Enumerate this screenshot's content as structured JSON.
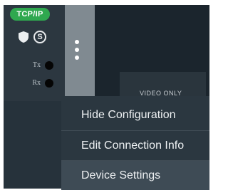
{
  "status": {
    "protocol_badge": "TCP/IP",
    "security_icon": "shield-icon",
    "secure_icon_letter": "S",
    "tx_label": "Tx",
    "rx_label": "Rx"
  },
  "menu_button": {
    "icon": "kebab-menu-icon"
  },
  "video_tile": {
    "label": "VIDEO ONLY"
  },
  "context_menu": {
    "items": [
      {
        "label": "Hide Configuration",
        "highlighted": false
      },
      {
        "label": "Edit Connection Info",
        "highlighted": false
      },
      {
        "label": "Device Settings",
        "highlighted": true
      }
    ]
  },
  "colors": {
    "badge_green": "#2fa84f",
    "panel_dark": "#2c3740",
    "menu_strip_gray": "#808a91",
    "menu_background": "#2b3740",
    "highlight": "#3e4b55"
  }
}
